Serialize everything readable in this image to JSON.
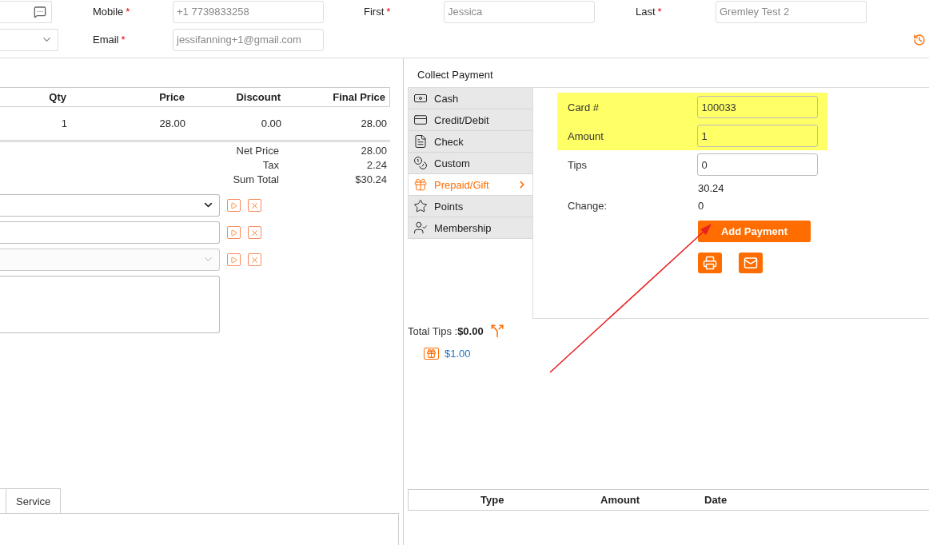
{
  "header": {
    "fields": [
      {
        "label": "Mobile",
        "required": "*",
        "value": "+1 7739833258"
      },
      {
        "label": "First",
        "required": "*",
        "value": "Jessica"
      },
      {
        "label": "Last",
        "required": "*",
        "value": "Gremley Test 2"
      },
      {
        "label": "Email",
        "required": "*",
        "value": "jessifanning+1@gmail.com"
      }
    ]
  },
  "order": {
    "columns": [
      "Qty",
      "Price",
      "Discount",
      "Final Price"
    ],
    "rows": [
      [
        "1",
        "28.00",
        "0.00",
        "28.00"
      ]
    ],
    "summary": [
      {
        "label": "Net Price",
        "value": "28.00"
      },
      {
        "label": "Tax",
        "value": "2.24"
      },
      {
        "label": "Sum Total",
        "value": "$30.24"
      }
    ],
    "controls": [
      {
        "kind": "select",
        "disabled": false
      },
      {
        "kind": "input",
        "disabled": false
      },
      {
        "kind": "select",
        "disabled": true
      },
      {
        "kind": "textarea",
        "disabled": false
      }
    ],
    "tabs": [
      {
        "label": "Service"
      }
    ]
  },
  "payment": {
    "title": "Collect Payment",
    "methods": [
      {
        "label": "Cash",
        "selected": false
      },
      {
        "label": "Credit/Debit",
        "selected": false
      },
      {
        "label": "Check",
        "selected": false
      },
      {
        "label": "Custom",
        "selected": false
      },
      {
        "label": "Prepaid/Gift",
        "selected": true
      },
      {
        "label": "Points",
        "selected": false
      },
      {
        "label": "Membership",
        "selected": false
      }
    ],
    "fields": [
      {
        "label": "Card #",
        "value": "100033",
        "highlighted": true
      },
      {
        "label": "Amount",
        "value": "1",
        "highlighted": true
      },
      {
        "label": "Tips",
        "value": "0",
        "highlighted": false
      }
    ],
    "total": "30.24",
    "change_label": "Change:",
    "change": "0",
    "button": "Add Payment",
    "total_tips_label": "Total Tips :",
    "total_tips": "$0.00",
    "payments": [
      {
        "amount": "$1.00"
      }
    ],
    "table": {
      "columns": [
        "Type",
        "Amount",
        "Date"
      ]
    }
  }
}
